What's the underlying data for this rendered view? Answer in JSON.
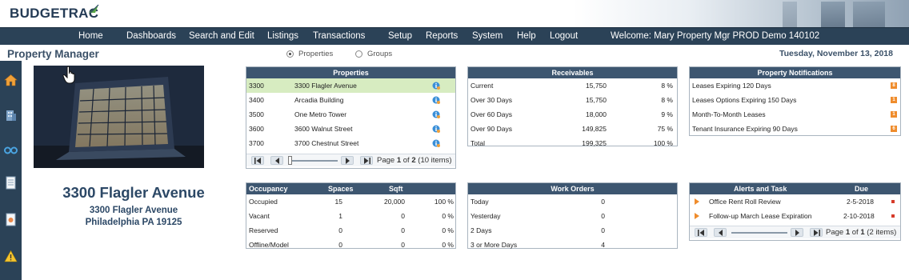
{
  "app": {
    "logo_text": "BUDGETRAC"
  },
  "nav": {
    "items": [
      "Home",
      "Dashboards",
      "Search and Edit",
      "Listings",
      "Transactions",
      "Setup",
      "Reports",
      "System",
      "Help",
      "Logout"
    ],
    "welcome": "Welcome: Mary Property Mgr  PROD Demo 140102"
  },
  "page": {
    "title": "Property Manager",
    "view_options": [
      "Properties",
      "Groups"
    ],
    "selected_view": "Properties",
    "date": "Tuesday, November 13, 2018"
  },
  "selected_property": {
    "name": "3300 Flagler Avenue",
    "address_line1": "3300 Flagler Avenue",
    "address_line2": "Philadelphia PA 19125"
  },
  "properties_panel": {
    "title": "Properties",
    "rows": [
      {
        "code": "3300",
        "name": "3300 Flagler Avenue"
      },
      {
        "code": "3400",
        "name": "Arcadia Building"
      },
      {
        "code": "3500",
        "name": "One Metro Tower"
      },
      {
        "code": "3600",
        "name": "3600 Walnut Street"
      },
      {
        "code": "3700",
        "name": "3700 Chestnut Street"
      }
    ],
    "pager": {
      "page_label": "Page",
      "page": "1",
      "of_label": "of",
      "total_pages": "2",
      "items_text": "(10 items)"
    }
  },
  "receivables_panel": {
    "title": "Receivables",
    "rows": [
      {
        "label": "Current",
        "amount": "15,750",
        "pct": "8 %"
      },
      {
        "label": "Over 30 Days",
        "amount": "15,750",
        "pct": "8 %"
      },
      {
        "label": "Over 60 Days",
        "amount": "18,000",
        "pct": "9 %"
      },
      {
        "label": "Over 90 Days",
        "amount": "149,825",
        "pct": "75 %"
      },
      {
        "label": "Total",
        "amount": "199,325",
        "pct": "100 %"
      }
    ]
  },
  "notifications_panel": {
    "title": "Property Notifications",
    "rows": [
      {
        "label": "Leases Expiring 120 Days",
        "count": "8"
      },
      {
        "label": "Leases Options Expiring 150 Days",
        "count": "1"
      },
      {
        "label": "Month-To-Month Leases",
        "count": "1"
      },
      {
        "label": "Tenant Insurance Expiring 90 Days",
        "count": "6"
      }
    ]
  },
  "occupancy_panel": {
    "headers": [
      "Occupancy",
      "Spaces",
      "Sqft"
    ],
    "rows": [
      {
        "label": "Occupied",
        "spaces": "15",
        "sqft": "20,000",
        "pct": "100 %"
      },
      {
        "label": "Vacant",
        "spaces": "1",
        "sqft": "0",
        "pct": "0 %"
      },
      {
        "label": "Reserved",
        "spaces": "0",
        "sqft": "0",
        "pct": "0 %"
      },
      {
        "label": "Offline/Model",
        "spaces": "0",
        "sqft": "0",
        "pct": "0 %"
      }
    ]
  },
  "work_orders_panel": {
    "title": "Work Orders",
    "rows": [
      {
        "label": "Today",
        "count": "0"
      },
      {
        "label": "Yesterday",
        "count": "0"
      },
      {
        "label": "2 Days",
        "count": "0"
      },
      {
        "label": "3 or More Days",
        "count": "4"
      }
    ]
  },
  "alerts_panel": {
    "headers": [
      "Alerts and Task",
      "Due"
    ],
    "rows": [
      {
        "label": "Office Rent Roll Review",
        "due": "2-5-2018"
      },
      {
        "label": "Follow-up March Lease Expiration",
        "due": "2-10-2018"
      }
    ],
    "pager": {
      "page_label": "Page",
      "page": "1",
      "of_label": "of",
      "total_pages": "1",
      "items_text": "(2 items)"
    }
  },
  "colors": {
    "nav_bg": "#2b4257",
    "panel_header": "#3d5670",
    "title_blue": "#2c4866",
    "selected_row": "#d7ecc1",
    "badge_orange": "#ef8c2c",
    "flag_red": "#d63b2a"
  },
  "icons": [
    "home-icon",
    "building-icon",
    "binoculars-icon",
    "document-icon",
    "report-icon",
    "warning-icon",
    "info-icon",
    "hand-cursor-icon"
  ]
}
